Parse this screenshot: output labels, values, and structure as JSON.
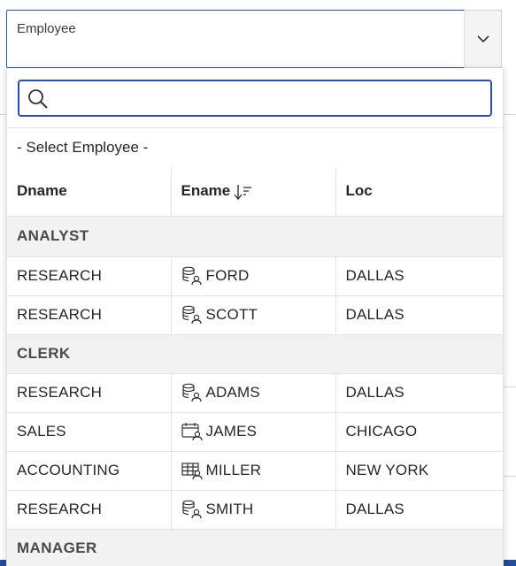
{
  "field": {
    "label": "Employee"
  },
  "popup": {
    "search": {
      "value": "",
      "placeholder": ""
    },
    "null_option": "- Select Employee -",
    "columns": [
      {
        "label": "Dname"
      },
      {
        "label": "Ename",
        "sort": "descending"
      },
      {
        "label": "Loc"
      }
    ],
    "groups": [
      {
        "title": "ANALYST",
        "rows": [
          {
            "dname": "RESEARCH",
            "ename": "FORD",
            "icon": "database-user-icon",
            "loc": "DALLAS"
          },
          {
            "dname": "RESEARCH",
            "ename": "SCOTT",
            "icon": "database-user-icon",
            "loc": "DALLAS"
          }
        ]
      },
      {
        "title": "CLERK",
        "rows": [
          {
            "dname": "RESEARCH",
            "ename": "ADAMS",
            "icon": "database-user-icon",
            "loc": "DALLAS"
          },
          {
            "dname": "SALES",
            "ename": "JAMES",
            "icon": "calendar-user-icon",
            "loc": "CHICAGO"
          },
          {
            "dname": "ACCOUNTING",
            "ename": "MILLER",
            "icon": "table-user-icon",
            "loc": "NEW YORK"
          },
          {
            "dname": "RESEARCH",
            "ename": "SMITH",
            "icon": "database-user-icon",
            "loc": "DALLAS"
          }
        ]
      },
      {
        "title": "MANAGER",
        "rows": []
      }
    ]
  },
  "colors": {
    "accent": "#2b4fa8",
    "group_bg": "#f2f2f2",
    "border": "#e3e3e3"
  }
}
